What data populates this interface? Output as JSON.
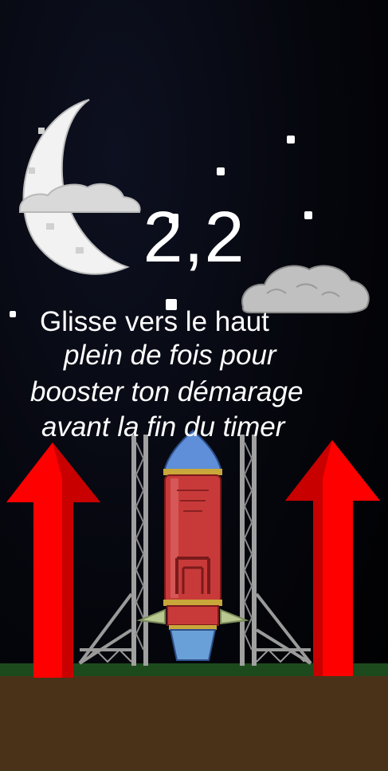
{
  "timer": {
    "value": "2,2"
  },
  "instructions": {
    "line1": "Glisse vers le haut",
    "line2": "plein de fois pour",
    "line3": "booster ton démarage",
    "line4": "avant la fin du timer"
  },
  "icons": [
    "moon-icon",
    "cloud-icon",
    "rocket-icon",
    "up-arrow-icon"
  ],
  "colors": {
    "sky": "#05060c",
    "arrow": "#ff0000",
    "arrow_shade": "#c80000",
    "rocket_body": "#c83a3a",
    "rocket_nose": "#5f8fd8",
    "grass": "#1d4a1d",
    "ground": "#4a3218",
    "tower": "#9a9a9a"
  }
}
